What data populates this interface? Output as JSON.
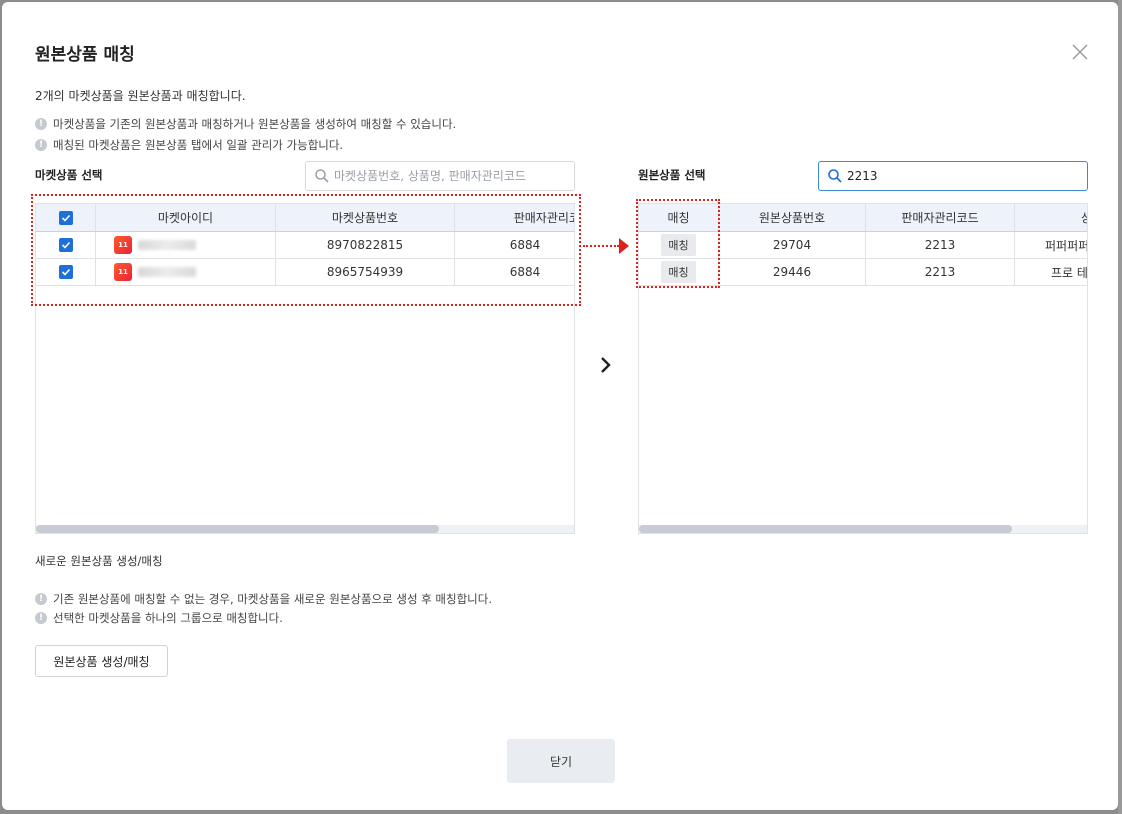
{
  "dialog": {
    "title": "원본상품 매칭",
    "description": "2개의 마켓상품을 원본상품과 매칭합니다.",
    "info_lines": [
      "마켓상품을 기존의 원본상품과 매칭하거나 원본상품을 생성하여 매칭할 수 있습니다.",
      "매칭된 마켓상품은 원본상품 탭에서 일괄 관리가 가능합니다."
    ]
  },
  "market": {
    "section_label": "마켓상품 선택",
    "search_placeholder": "마켓상품번호, 상품명, 판매자관리코드",
    "search_value": "",
    "columns": [
      "마켓아이디",
      "마켓상품번호",
      "판매자관리코드"
    ],
    "rows": [
      {
        "checked": true,
        "market_logo": "11st-logo",
        "market_id": "",
        "product_no": "8970822815",
        "seller_code": "6884"
      },
      {
        "checked": true,
        "market_logo": "11st-logo",
        "market_id": "",
        "product_no": "8965754939",
        "seller_code": "6884"
      }
    ]
  },
  "original": {
    "section_label": "원본상품 선택",
    "search_value": "2213",
    "columns": [
      "매칭",
      "원본상품번호",
      "판매자관리코드",
      "상"
    ],
    "rows": [
      {
        "match_label": "매칭",
        "product_no": "29704",
        "seller_code": "2213",
        "name": "퍼퍼퍼퍼퍼"
      },
      {
        "match_label": "매칭",
        "product_no": "29446",
        "seller_code": "2213",
        "name": "프로 테"
      }
    ]
  },
  "new_section": {
    "label": "새로운 원본상품 생성/매칭",
    "info_lines": [
      "기존 원본상품에 매칭할 수 없는 경우, 마켓상품을 새로운 원본상품으로 생성 후 매칭합니다.",
      "선택한 마켓상품을 하나의 그룹으로 매칭합니다."
    ],
    "create_button": "원본상품 생성/매칭"
  },
  "footer": {
    "close_button": "닫기"
  },
  "colors": {
    "accent": "#1f6fd8",
    "highlight": "#e0201b",
    "header_bg": "#eef3fb"
  }
}
